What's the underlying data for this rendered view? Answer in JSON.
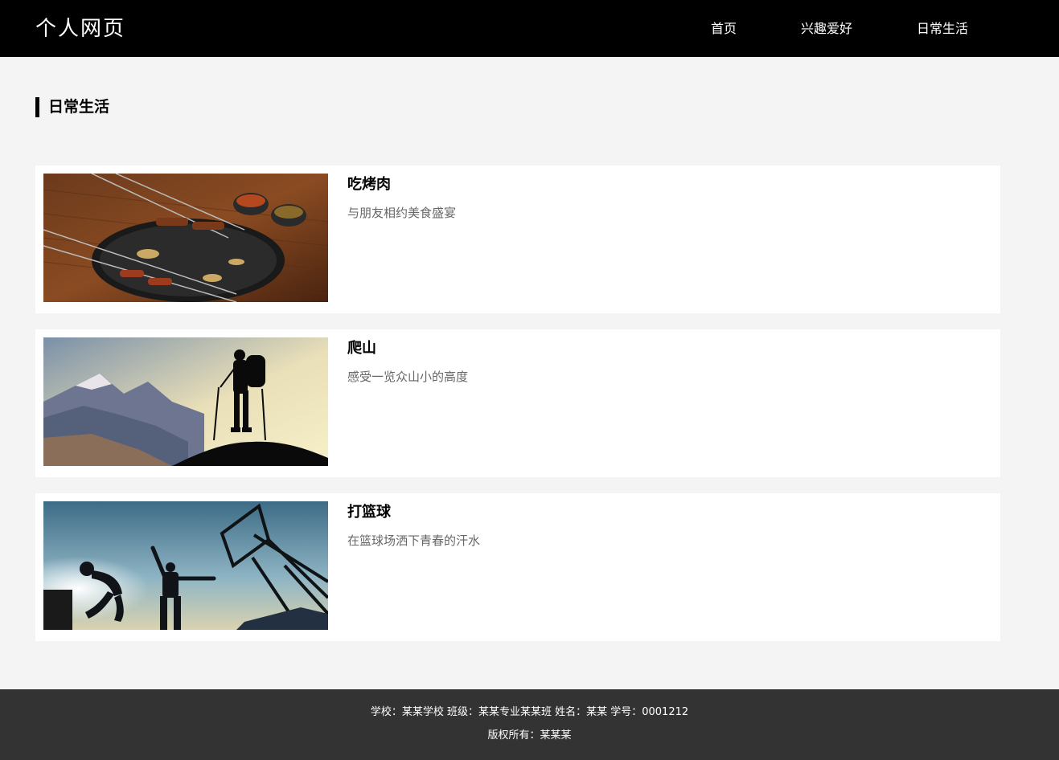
{
  "header": {
    "logo": "个人网页",
    "nav": [
      "首页",
      "兴趣爱好",
      "日常生活"
    ]
  },
  "section": {
    "title": "日常生活"
  },
  "cards": [
    {
      "title": "吃烤肉",
      "desc": "与朋友相约美食盛宴",
      "image": "bbq-photo"
    },
    {
      "title": "爬山",
      "desc": "感受一览众山小的高度",
      "image": "hiking-photo"
    },
    {
      "title": "打篮球",
      "desc": "在篮球场洒下青春的汗水",
      "image": "basketball-photo"
    }
  ],
  "footer": {
    "line1": "学校：某某学校 班级：某某专业某某班 姓名：某某 学号：0001212",
    "line2": "版权所有：某某某"
  },
  "colors": {
    "header_bg": "#000000",
    "page_bg": "#f4f4f4",
    "footer_bg": "#333333",
    "desc_text": "#666666"
  }
}
